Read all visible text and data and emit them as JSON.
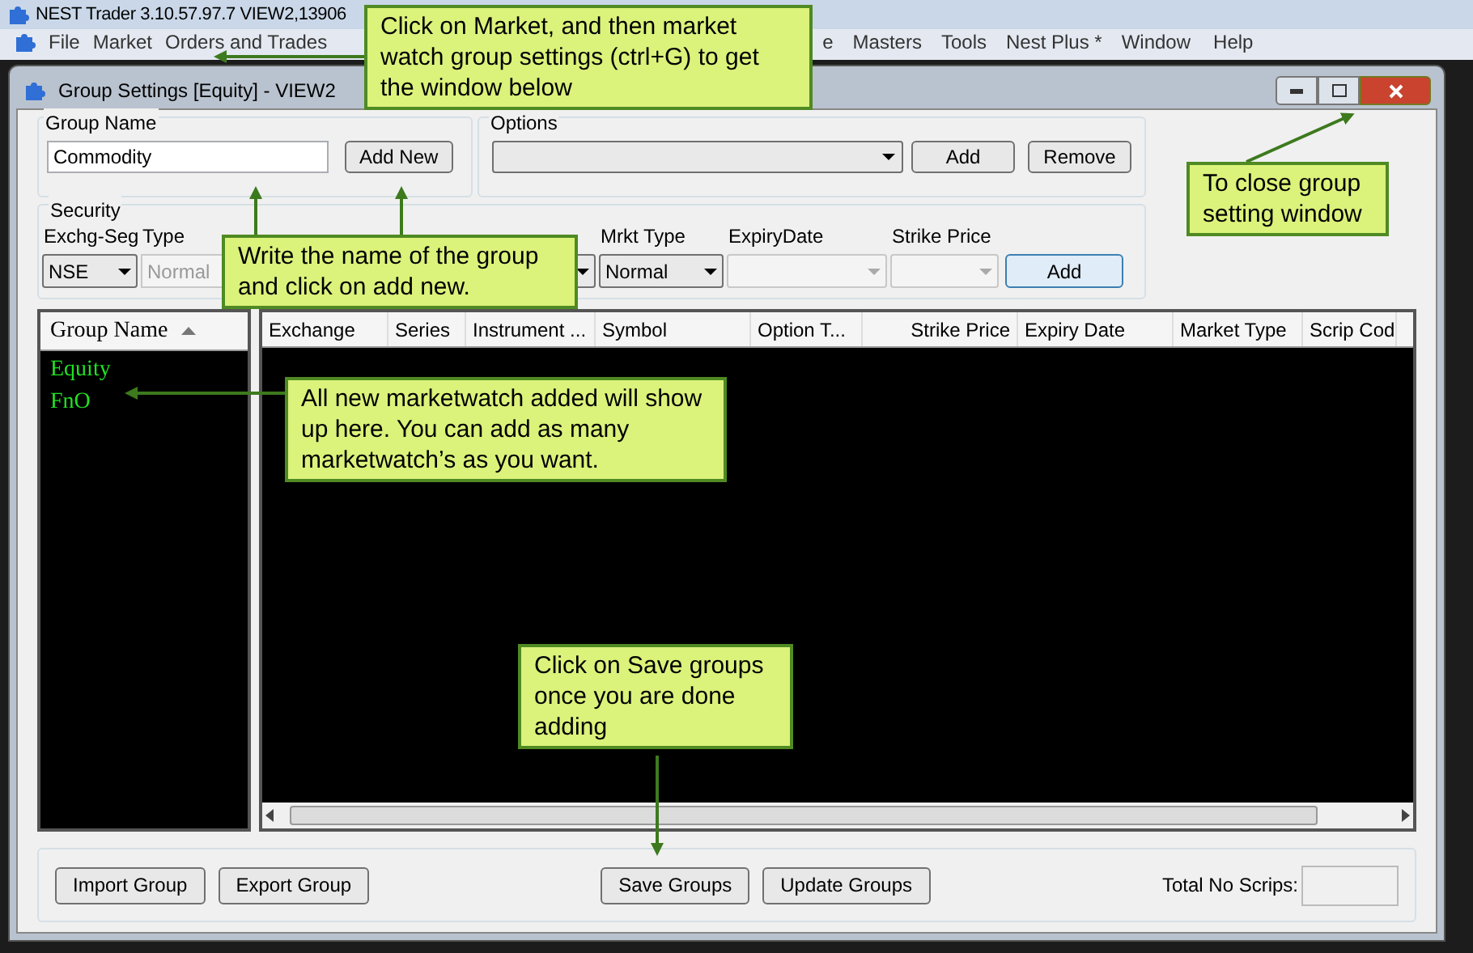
{
  "app_title": "NEST Trader 3.10.57.97.7 VIEW2,13906",
  "menu": [
    {
      "label": "File"
    },
    {
      "label": "Market"
    },
    {
      "label": "Orders and Trades"
    },
    {
      "label": "e"
    },
    {
      "label": "Masters"
    },
    {
      "label": "Tools"
    },
    {
      "label": "Nest Plus *"
    },
    {
      "label": "Window"
    },
    {
      "label": "Help"
    }
  ],
  "window": {
    "title": "Group Settings [Equity] - VIEW2"
  },
  "group_name": {
    "label": "Group Name",
    "value": "Commodity",
    "button": "Add New"
  },
  "options": {
    "label": "Options",
    "buttons": [
      "Add",
      "Remove"
    ]
  },
  "security": {
    "label": "Security",
    "fields": [
      {
        "kind": "select",
        "label": "Exchg-Seg",
        "value": "NSE",
        "disabled": false
      },
      {
        "kind": "input",
        "label": "Type",
        "value": "Normal",
        "disabled": true
      },
      {
        "kind": "select",
        "disabled": false
      },
      {
        "kind": "select",
        "label": "Mrkt Type",
        "value": "Normal",
        "disabled": false
      },
      {
        "kind": "select",
        "label": "ExpiryDate",
        "disabled": true
      },
      {
        "kind": "select",
        "label": "Strike Price",
        "disabled": true
      }
    ],
    "button": "Add"
  },
  "group_list": {
    "header": "Group Name",
    "items": [
      "Equity",
      "FnO"
    ]
  },
  "grid": {
    "columns": [
      "Exchange",
      "Series",
      "Instrument ...",
      "Symbol",
      "Option T...",
      "Strike Price",
      "Expiry Date",
      "Market Type",
      "Scrip Cod"
    ]
  },
  "footer": {
    "buttons": [
      "Import Group",
      "Export Group",
      "Save Groups",
      "Update Groups"
    ],
    "total_label": "Total No Scrips:"
  },
  "callouts": [
    {
      "text": "Click on Market, and then market watch group settings (ctrl+G) to get the window below"
    },
    {
      "text": "Write the name of the group and click on add new."
    },
    {
      "text": "All new marketwatch added will show up here. You can add as many marketwatch’s as you want."
    },
    {
      "text": "To close group setting window"
    },
    {
      "text": "Click on Save groups once you are done adding"
    }
  ]
}
